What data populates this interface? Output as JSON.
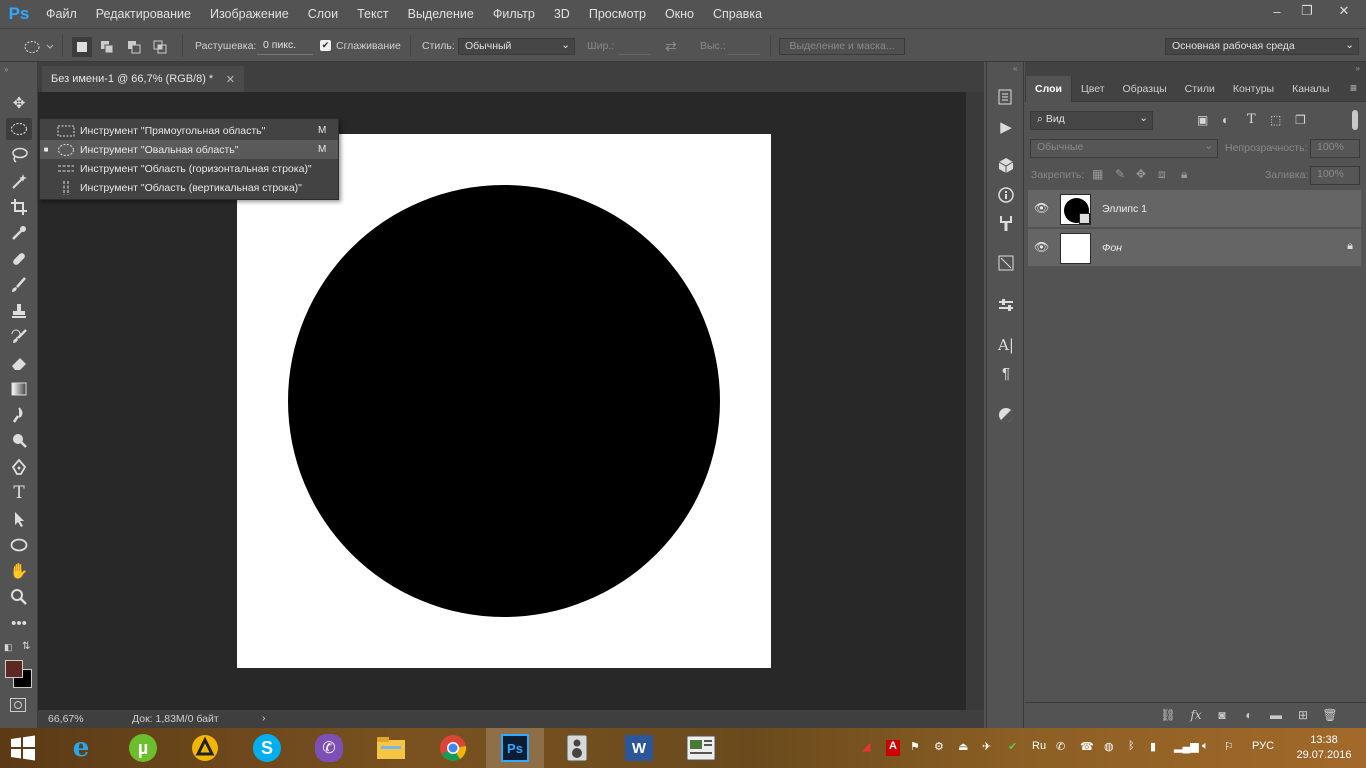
{
  "app": {
    "logo": "Ps"
  },
  "menu": [
    "Файл",
    "Редактирование",
    "Изображение",
    "Слои",
    "Текст",
    "Выделение",
    "Фильтр",
    "3D",
    "Просмотр",
    "Окно",
    "Справка"
  ],
  "window_controls": {
    "minimize": "–",
    "restore": "❐",
    "close": "✕"
  },
  "options": {
    "feather_label": "Растушевка:",
    "feather_value": "0 пикс.",
    "antialias_label": "Сглаживание",
    "antialias_checked": true,
    "style_label": "Стиль:",
    "style_value": "Обычный",
    "width_label": "Шир.:",
    "height_label": "Выс.:",
    "mask_button": "Выделение и маска...",
    "workspace": "Основная рабочая среда"
  },
  "document": {
    "tab_title": "Без имени-1 @ 66,7% (RGB/8) *",
    "zoom": "66,67%",
    "doc_info": "Док: 1,83M/0 байт",
    "colors": {
      "canvas": "#ffffff",
      "shape": "#000000",
      "foreground": "#5a2a22",
      "background": "#000000"
    }
  },
  "tool_flyout": [
    {
      "label": "Инструмент \"Прямоугольная область\"",
      "key": "M",
      "icon": "rect-marquee-icon",
      "selected": false
    },
    {
      "label": "Инструмент \"Овальная область\"",
      "key": "M",
      "icon": "ellipse-marquee-icon",
      "selected": true
    },
    {
      "label": "Инструмент \"Область (горизонтальная строка)\"",
      "key": "",
      "icon": "single-row-marquee-icon",
      "selected": false
    },
    {
      "label": "Инструмент \"Область (вертикальная строка)\"",
      "key": "",
      "icon": "single-column-marquee-icon",
      "selected": false
    }
  ],
  "layers_panel": {
    "tabs": [
      "Слои",
      "Цвет",
      "Образцы",
      "Стили",
      "Контуры",
      "Каналы"
    ],
    "filter_label": "Вид",
    "blend_mode": "Обычные",
    "opacity_label": "Непрозрачность:",
    "opacity_value": "100%",
    "lock_label": "Закрепить:",
    "fill_label": "Заливка:",
    "fill_value": "100%",
    "layers": [
      {
        "name": "Эллипс 1",
        "visible": true,
        "selected": true,
        "thumb": "ellipse"
      },
      {
        "name": "Фон",
        "visible": true,
        "selected": false,
        "thumb": "white",
        "locked": true
      }
    ]
  },
  "taskbar": {
    "apps": [
      "start-icon",
      "ie-icon",
      "utorrent-icon",
      "archicad-icon",
      "skype-icon",
      "viber-icon",
      "explorer-icon",
      "chrome-icon",
      "photoshop-icon",
      "speaker-app-icon",
      "word-icon",
      "presentation-icon"
    ],
    "lang": "РУС",
    "time": "13:38",
    "date": "29.07.2016"
  }
}
